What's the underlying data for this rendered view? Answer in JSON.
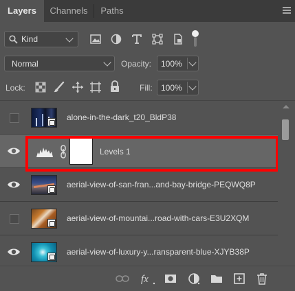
{
  "tabs": [
    {
      "label": "Layers",
      "active": true
    },
    {
      "label": "Channels",
      "active": false
    },
    {
      "label": "Paths",
      "active": false
    }
  ],
  "filter": {
    "kind_label": "Kind",
    "icons": [
      "pixel-filter-icon",
      "adjustment-filter-icon",
      "type-filter-icon",
      "shape-filter-icon",
      "smart-object-filter-icon",
      "filter-toggle-icon"
    ]
  },
  "blend": {
    "mode": "Normal",
    "opacity_label": "Opacity:",
    "opacity_value": "100%"
  },
  "lock": {
    "label": "Lock:",
    "fill_label": "Fill:",
    "fill_value": "100%"
  },
  "layers": [
    {
      "name": "alone-in-the-dark_t20_BldP38",
      "visible": false,
      "type": "smart-object"
    },
    {
      "name": "Levels 1",
      "visible": true,
      "type": "adjustment",
      "selected": true
    },
    {
      "name": "aerial-view-of-san-fran...and-bay-bridge-PEQWQ8P",
      "visible": true,
      "type": "smart-object"
    },
    {
      "name": "aerial-view-of-mountai...road-with-cars-E3U2XQM",
      "visible": false,
      "type": "smart-object"
    },
    {
      "name": "aerial-view-of-luxury-y...ransparent-blue-XJYB38P",
      "visible": true,
      "type": "smart-object"
    }
  ],
  "bottom_icons": [
    "link-layers-icon",
    "fx-icon",
    "add-mask-icon",
    "new-adjustment-icon",
    "new-group-icon",
    "new-layer-icon",
    "delete-icon"
  ],
  "colors": {
    "panel_bg": "#535353",
    "tabbar_bg": "#3b3b3b",
    "selected_row": "#666666",
    "highlight": "#ff0000"
  }
}
